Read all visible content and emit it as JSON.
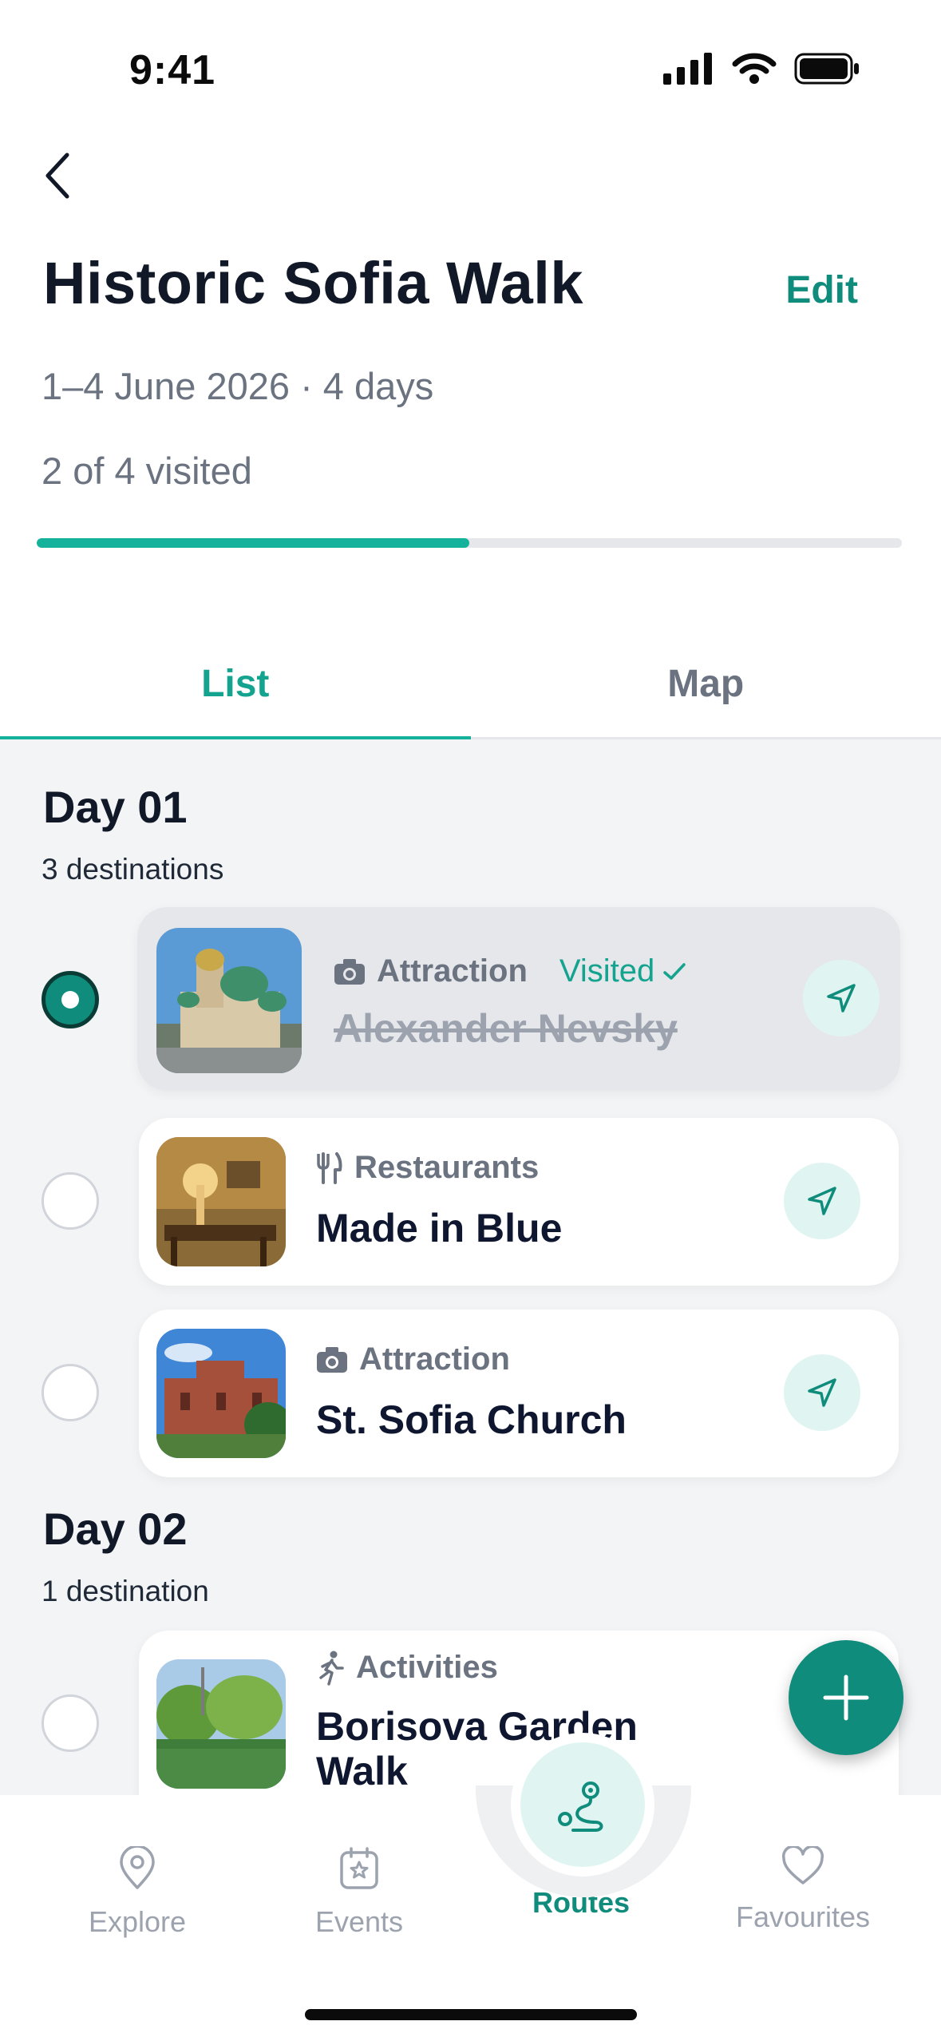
{
  "status_bar": {
    "time": "9:41"
  },
  "header": {
    "title": "Historic Sofia Walk",
    "edit_label": "Edit",
    "dates": "1–4 June 2026 · 4 days",
    "visited_text": "2 of 4 visited",
    "progress_fraction": 0.5
  },
  "tabs": [
    {
      "label": "List",
      "active": true
    },
    {
      "label": "Map",
      "active": false
    }
  ],
  "days": [
    {
      "title": "Day 01",
      "subtitle": "3 destinations",
      "items": [
        {
          "category": "Attraction",
          "category_icon": "camera-icon",
          "visited_label": "Visited",
          "name": "Alexander Nevsky",
          "visited": true
        },
        {
          "category": "Restaurants",
          "category_icon": "fork-knife-icon",
          "name": "Made in Blue",
          "visited": false
        },
        {
          "category": "Attraction",
          "category_icon": "camera-icon",
          "name": "St. Sofia Church",
          "visited": false
        }
      ]
    },
    {
      "title": "Day 02",
      "subtitle": "1 destination",
      "items": [
        {
          "category": "Activities",
          "category_icon": "running-person-icon",
          "name": "Borisova Garden Walk",
          "name_line1": "Borisova Garden",
          "name_line2": "Walk",
          "visited": false
        }
      ]
    }
  ],
  "bottom_nav": [
    {
      "label": "Explore",
      "icon": "map-pin-icon",
      "active": false
    },
    {
      "label": "Events",
      "icon": "calendar-star-icon",
      "active": false
    },
    {
      "label": "Routes",
      "icon": "route-icon",
      "active": true
    },
    {
      "label": "Favourites",
      "icon": "heart-icon",
      "active": false
    }
  ],
  "colors": {
    "accent": "#0f8c7c",
    "accent_light": "#14b29a",
    "muted": "#6b7280",
    "list_bg": "#f3f4f6"
  }
}
